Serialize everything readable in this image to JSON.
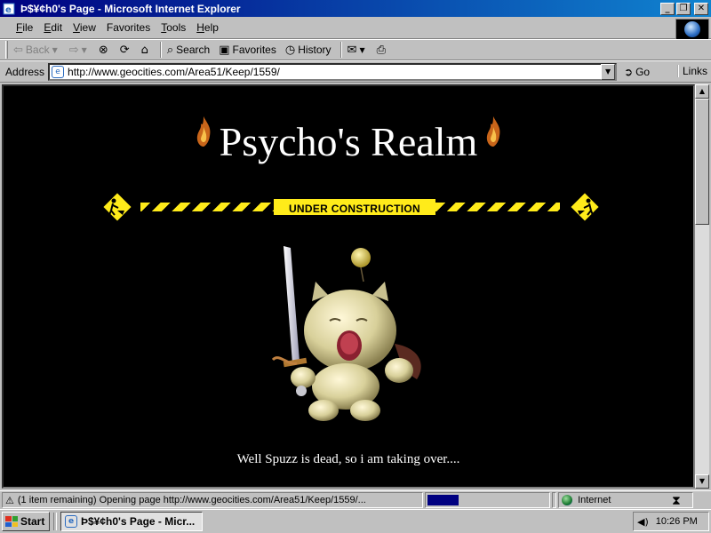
{
  "window": {
    "title": "Þ$¥¢h0's Page - Microsoft Internet Explorer",
    "minimize": "_",
    "maximize": "❐",
    "close": "✕"
  },
  "menubar": {
    "items": [
      {
        "key": "F",
        "rest": "ile"
      },
      {
        "key": "E",
        "rest": "dit"
      },
      {
        "key": "V",
        "rest": "iew"
      },
      {
        "key": "",
        "rest": "Favorites"
      },
      {
        "key": "T",
        "rest": "ools"
      },
      {
        "key": "H",
        "rest": "elp"
      }
    ]
  },
  "toolbar": {
    "back": "Back",
    "forward": "",
    "stop": "",
    "refresh": "",
    "home": "",
    "search": "Search",
    "favorites": "Favorites",
    "history": "History"
  },
  "address": {
    "label": "Address",
    "url": "http://www.geocities.com/Area51/Keep/1559/",
    "go": "Go",
    "links": "Links"
  },
  "page": {
    "heading": "Psycho's Realm",
    "construction_label": "UNDER CONSTRUCTION",
    "caption": "Well Spuzz is dead, so i am taking over...."
  },
  "status": {
    "text": "(1 item remaining) Opening page http://www.geocities.com/Area51/Keep/1559/...",
    "progress_fraction": 0.25,
    "zone": "Internet"
  },
  "taskbar": {
    "start": "Start",
    "task_title": "Þ$¥¢h0's Page - Micr...",
    "clock": "10:26 PM"
  },
  "colors": {
    "title_active": "#000080",
    "construction_yellow": "#ffeb1a",
    "page_bg": "#000000"
  }
}
